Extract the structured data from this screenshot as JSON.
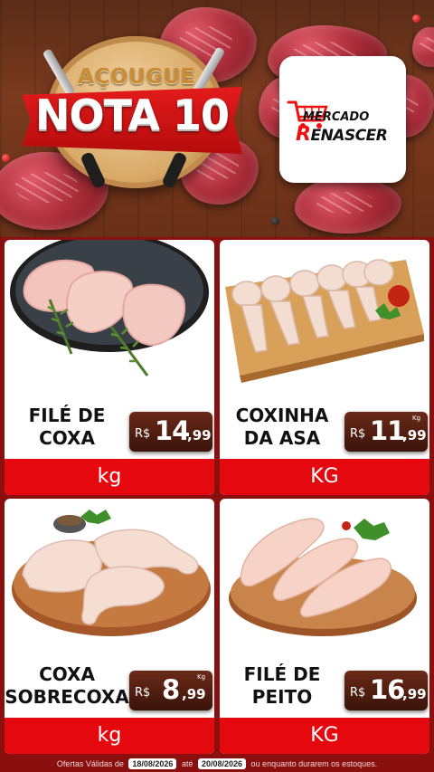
{
  "header": {
    "brand_top": "AÇOUGUE",
    "brand_main": "NOTA 10",
    "store_logo": {
      "line1": "MERCADO",
      "line2_first": "R",
      "line2_rest": "ENASCER"
    }
  },
  "products": [
    {
      "name_line1": "FILÉ DE",
      "name_line2": "COXA",
      "currency": "R$",
      "price_int": "14",
      "price_dec": ",99",
      "price_unit_tag": "",
      "unit": "kg"
    },
    {
      "name_line1": "COXINHA",
      "name_line2": "DA ASA",
      "currency": "R$",
      "price_int": "11",
      "price_dec": ",99",
      "price_unit_tag": "Kg",
      "unit": "KG"
    },
    {
      "name_line1": "COXA",
      "name_line2": "SOBRECOXA",
      "currency": "R$",
      "price_int": "8",
      "price_dec": ",99",
      "price_unit_tag": "Kg",
      "unit": "kg"
    },
    {
      "name_line1": "FILÉ DE",
      "name_line2": "PEITO",
      "currency": "R$",
      "price_int": "16",
      "price_dec": ",99",
      "price_unit_tag": "",
      "unit": "KG"
    }
  ],
  "footer": {
    "prefix": "Ofertas Válidas de",
    "date_start": "18/08/2026",
    "connector": "até",
    "date_end": "20/08/2026",
    "suffix": "ou enquanto durarem os estoques."
  },
  "colors": {
    "page_bg": "#8a1010",
    "unit_bar": "#e5090f",
    "price_tag": "#4a1a0e",
    "accent_red": "#e31b1b"
  }
}
